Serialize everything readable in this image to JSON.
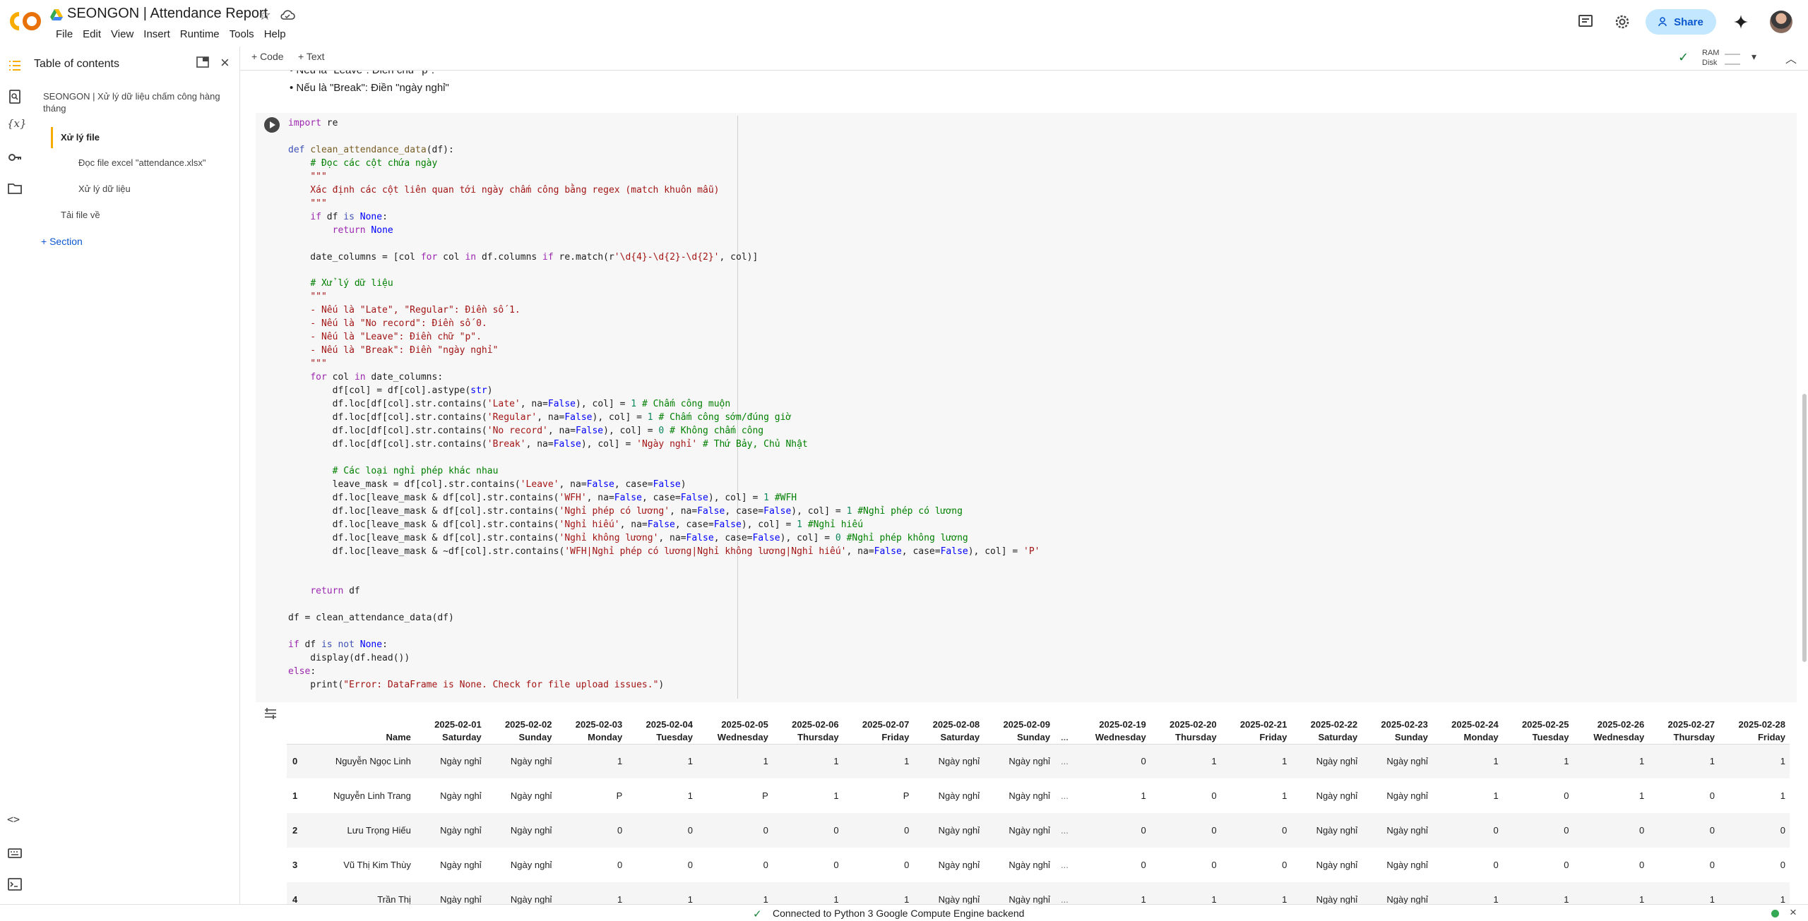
{
  "header": {
    "title": "SEONGON | Attendance Report",
    "menu": [
      "File",
      "Edit",
      "View",
      "Insert",
      "Runtime",
      "Tools",
      "Help"
    ],
    "share_label": "Share",
    "brand_color": "#f9ab00",
    "share_bg": "#c2e7ff"
  },
  "toolbar": {
    "code_label": "+ Code",
    "text_label": "+ Text",
    "ram_label": "RAM",
    "disk_label": "Disk"
  },
  "sidebar": {
    "title": "Table of contents",
    "items": [
      {
        "label": "SEONGON | Xử lý dữ liệu chấm công hàng tháng"
      },
      {
        "label": "Xử lý file"
      },
      {
        "label": "Đọc file excel \"attendance.xlsx\""
      },
      {
        "label": "Xử lý dữ liệu"
      },
      {
        "label": "Tải file về"
      }
    ],
    "add_section_label": "+ Section"
  },
  "markdown": {
    "line1": "Nếu là \"Leave\": Điền chữ \"p\".",
    "line2": "Nếu là \"Break\": Điền \"ngày nghỉ\""
  },
  "table": {
    "name_header": "Name",
    "ellipsis": "...",
    "columns": [
      {
        "date": "2025-02-01",
        "day": "Saturday"
      },
      {
        "date": "2025-02-02",
        "day": "Sunday"
      },
      {
        "date": "2025-02-03",
        "day": "Monday"
      },
      {
        "date": "2025-02-04",
        "day": "Tuesday"
      },
      {
        "date": "2025-02-05",
        "day": "Wednesday"
      },
      {
        "date": "2025-02-06",
        "day": "Thursday"
      },
      {
        "date": "2025-02-07",
        "day": "Friday"
      },
      {
        "date": "2025-02-08",
        "day": "Saturday"
      },
      {
        "date": "2025-02-09",
        "day": "Sunday"
      },
      {
        "date": "2025-02-19",
        "day": "Wednesday"
      },
      {
        "date": "2025-02-20",
        "day": "Thursday"
      },
      {
        "date": "2025-02-21",
        "day": "Friday"
      },
      {
        "date": "2025-02-22",
        "day": "Saturday"
      },
      {
        "date": "2025-02-23",
        "day": "Sunday"
      },
      {
        "date": "2025-02-24",
        "day": "Monday"
      },
      {
        "date": "2025-02-25",
        "day": "Tuesday"
      },
      {
        "date": "2025-02-26",
        "day": "Wednesday"
      },
      {
        "date": "2025-02-27",
        "day": "Thursday"
      },
      {
        "date": "2025-02-28",
        "day": "Friday"
      }
    ],
    "rows": [
      {
        "idx": "0",
        "name": "Nguyễn Ngọc Linh",
        "vals": [
          "Ngày nghỉ",
          "Ngày nghỉ",
          "1",
          "1",
          "1",
          "1",
          "1",
          "Ngày nghỉ",
          "Ngày nghỉ",
          "0",
          "1",
          "1",
          "Ngày nghỉ",
          "Ngày nghỉ",
          "1",
          "1",
          "1",
          "1",
          "1"
        ]
      },
      {
        "idx": "1",
        "name": "Nguyễn Linh Trang",
        "vals": [
          "Ngày nghỉ",
          "Ngày nghỉ",
          "P",
          "1",
          "P",
          "1",
          "P",
          "Ngày nghỉ",
          "Ngày nghỉ",
          "1",
          "0",
          "1",
          "Ngày nghỉ",
          "Ngày nghỉ",
          "1",
          "0",
          "1",
          "0",
          "1"
        ]
      },
      {
        "idx": "2",
        "name": "Lưu Trọng Hiếu",
        "vals": [
          "Ngày nghỉ",
          "Ngày nghỉ",
          "0",
          "0",
          "0",
          "0",
          "0",
          "Ngày nghỉ",
          "Ngày nghỉ",
          "0",
          "0",
          "0",
          "Ngày nghỉ",
          "Ngày nghỉ",
          "0",
          "0",
          "0",
          "0",
          "0"
        ]
      },
      {
        "idx": "3",
        "name": "Vũ Thị Kim Thùy",
        "vals": [
          "Ngày nghỉ",
          "Ngày nghỉ",
          "0",
          "0",
          "0",
          "0",
          "0",
          "Ngày nghỉ",
          "Ngày nghỉ",
          "0",
          "0",
          "0",
          "Ngày nghỉ",
          "Ngày nghỉ",
          "0",
          "0",
          "0",
          "0",
          "0"
        ]
      },
      {
        "idx": "4",
        "name": "Trần Thị",
        "vals": [
          "Ngày nghỉ",
          "Ngày nghỉ",
          "1",
          "1",
          "1",
          "1",
          "1",
          "Ngày nghỉ",
          "Ngày nghỉ",
          "1",
          "1",
          "1",
          "Ngày nghỉ",
          "Ngày nghỉ",
          "1",
          "1",
          "1",
          "1",
          "1"
        ]
      }
    ]
  },
  "status": {
    "text": "Connected to Python 3 Google Compute Engine backend"
  }
}
